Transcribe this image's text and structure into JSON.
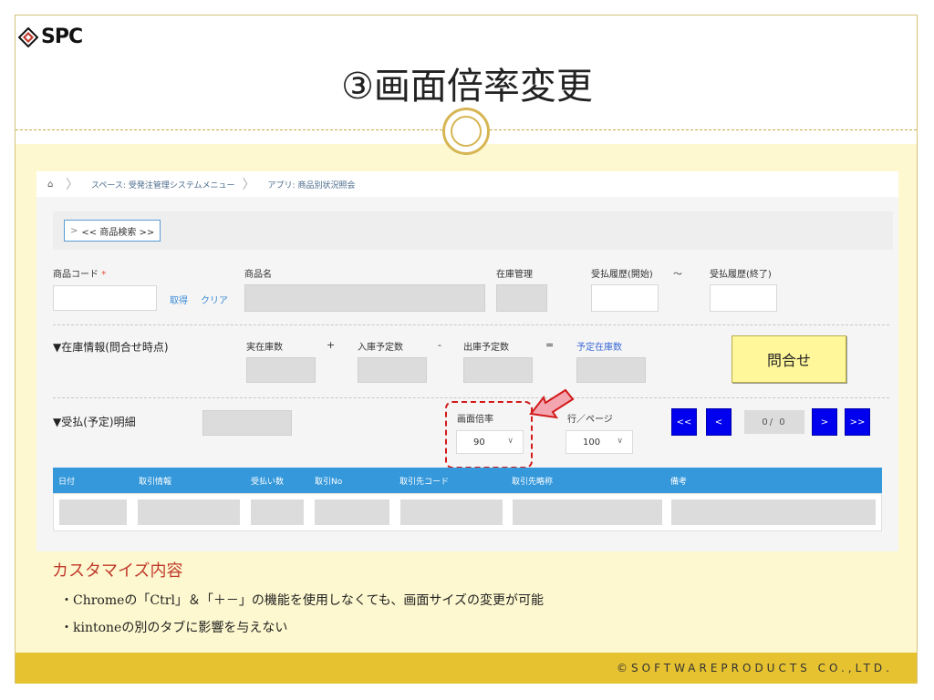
{
  "logo": {
    "text": "SPC"
  },
  "slide_title": "③画面倍率変更",
  "footer": {
    "copyright": "©SOFTWAREPRODUCTS CO.,LTD."
  },
  "app": {
    "breadcrumb": {
      "space": "スペース: 受発注管理システムメニュー",
      "app": "アプリ: 商品別状況照会"
    },
    "search_toggle_label": "<< 商品検索 >>",
    "fields": {
      "product_code": "商品コード",
      "required_mark": "*",
      "get_link": "取得",
      "clear_link": "クリア",
      "product_name": "商品名",
      "stock_mgmt": "在庫管理",
      "history_start": "受払履歴(開始)",
      "tilde": "～",
      "history_end": "受払履歴(終了)"
    },
    "stock_section": {
      "title": "▼在庫情報(問合せ時点)",
      "actual": "実在庫数",
      "plus": "+",
      "incoming": "入庫予定数",
      "minus": "-",
      "outgoing": "出庫予定数",
      "equals": "=",
      "planned": "予定在庫数",
      "inquiry_button": "問合せ"
    },
    "detail_section": {
      "title": "▼受払(予定)明細",
      "zoom_label": "画面倍率",
      "zoom_value": "90",
      "rows_label": "行／ページ",
      "rows_value": "100",
      "pager": {
        "first": "<<",
        "prev": "<",
        "info": "0/ 0",
        "next": ">",
        "last": ">>"
      }
    },
    "grid_columns": [
      "日付",
      "取引情報",
      "受払い数",
      "取引No",
      "取引先コード",
      "取引先略称",
      "備考"
    ],
    "accent_color": "#3498db",
    "highlight_color": "#d21a1a"
  },
  "description": {
    "title": "カスタマイズ内容",
    "lines": [
      "・Chromeの「Ctrl」＆「＋－」の機能を使用しなくても、画面サイズの変更が可能",
      "・kintoneの別のタブに影響を与えない"
    ]
  }
}
